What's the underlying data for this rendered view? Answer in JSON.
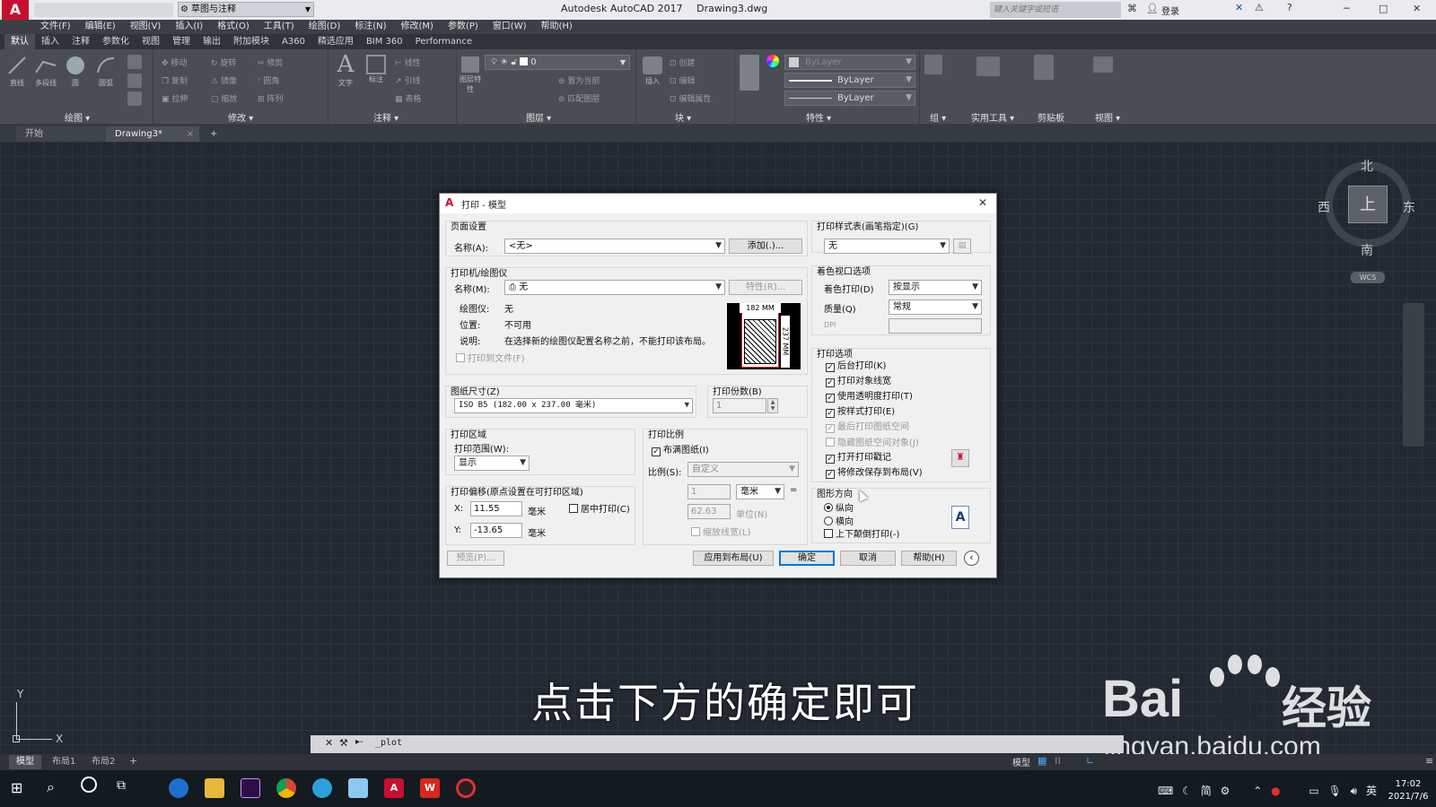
{
  "colors": {
    "canvas": "#222932",
    "dialog": "#f0f0f0",
    "accent": "#0078d7",
    "autocad_red": "#c8102e",
    "preview_red": "#e02020"
  },
  "titlebar": {
    "workspace": "草图与注释",
    "app_title": "Autodesk AutoCAD 2017",
    "file": "Drawing3.dwg",
    "search_placeholder": "键入关键字或短语",
    "login": "登录",
    "min": "─",
    "max": "□",
    "close": "✕"
  },
  "menubar": {
    "items": [
      "文件(F)",
      "编辑(E)",
      "视图(V)",
      "插入(I)",
      "格式(O)",
      "工具(T)",
      "绘图(D)",
      "标注(N)",
      "修改(M)",
      "参数(P)",
      "窗口(W)",
      "帮助(H)"
    ]
  },
  "ribbon": {
    "tabs": [
      "默认",
      "插入",
      "注释",
      "参数化",
      "视图",
      "管理",
      "输出",
      "附加模块",
      "A360",
      "精选应用",
      "BIM 360",
      "Performance"
    ],
    "draw_tools": [
      "直线",
      "多段线",
      "圆",
      "圆弧"
    ],
    "modify_tools": [
      "移动",
      "旋转",
      "修剪",
      "复制",
      "镜像",
      "圆角",
      "拉伸",
      "缩放",
      "阵列"
    ],
    "annotation_tools": [
      "文字",
      "标注",
      "线性",
      "引线",
      "表格"
    ],
    "layer_tools": [
      "图层特性",
      "置为当前",
      "匹配图层"
    ],
    "block_tools": [
      "插入",
      "创建",
      "编辑",
      "编辑属性"
    ],
    "layer_value": "0",
    "bylayer": [
      "ByLayer",
      "ByLayer",
      "ByLayer"
    ],
    "panel_labels": [
      "绘图",
      "修改",
      "注释",
      "图层",
      "块",
      "特性",
      "组",
      "实用工具",
      "剪贴板",
      "视图"
    ]
  },
  "filetabs": {
    "start": "开始",
    "current": "Drawing3*",
    "add": "+"
  },
  "viewcube": {
    "north": "北",
    "south": "南",
    "west": "西",
    "east": "东",
    "face": "上",
    "wcs": "WCS"
  },
  "ucs": {
    "y": "Y",
    "x": "X"
  },
  "dialog": {
    "title": "打印 - 模型",
    "close": "✕",
    "page_setup": {
      "title": "页面设置",
      "name_label": "名称(A):",
      "name_value": "<无>",
      "add_button": "添加(.)..."
    },
    "printer": {
      "title": "打印机/绘图仪",
      "name_label": "名称(M):",
      "name_value": "无",
      "properties_button": "特性(R)...",
      "plotter_label": "绘图仪:",
      "plotter_value": "无",
      "where_label": "位置:",
      "where_value": "不可用",
      "desc_label": "说明:",
      "desc_value": "在选择新的绘图仪配置名称之前，不能打印该布局。",
      "print_to_file": "打印到文件(F)",
      "preview_width": "182 MM",
      "preview_height": "237 MM"
    },
    "paper_size": {
      "title": "图纸尺寸(Z)",
      "value": "ISO B5 (182.00 x 237.00 毫米)"
    },
    "copies": {
      "title": "打印份数(B)",
      "value": "1"
    },
    "plot_area": {
      "title": "打印区域",
      "range_label": "打印范围(W):",
      "range_value": "显示"
    },
    "plot_offset": {
      "title": "打印偏移(原点设置在可打印区域)",
      "x_label": "X:",
      "x_value": "11.55",
      "x_unit": "毫米",
      "center_label": "居中打印(C)",
      "y_label": "Y:",
      "y_value": "-13.65",
      "y_unit": "毫米"
    },
    "plot_scale": {
      "title": "打印比例",
      "fit_paper": "布满图纸(I)",
      "fit_checked": true,
      "scale_label": "比例(S):",
      "scale_value": "自定义",
      "value1": "1",
      "unit_value": "毫米",
      "equals": "=",
      "value2": "62.63",
      "unit2": "单位(N)",
      "scale_lineweights": "缩放线宽(L)"
    },
    "style_table": {
      "title": "打印样式表(画笔指定)(G)",
      "value": "无"
    },
    "shaded": {
      "title": "着色视口选项",
      "shade_label": "着色打印(D)",
      "shade_value": "按显示",
      "quality_label": "质量(Q)",
      "quality_value": "常规",
      "dpi_label": "DPI",
      "dpi_value": ""
    },
    "plot_options": {
      "title": "打印选项",
      "items": [
        {
          "label": "后台打印(K)",
          "checked": "✓"
        },
        {
          "label": "打印对象线宽",
          "checked": "✓"
        },
        {
          "label": "使用透明度打印(T)",
          "checked": "✓"
        },
        {
          "label": "按样式打印(E)",
          "checked": "✓"
        },
        {
          "label": "最后打印图纸空间",
          "checked": "✓"
        },
        {
          "label": "隐藏图纸空间对象(J)",
          "checked": ""
        },
        {
          "label": "打开打印戳记",
          "checked": "✓"
        },
        {
          "label": "将修改保存到布局(V)",
          "checked": "✓"
        }
      ]
    },
    "orientation": {
      "title": "图形方向",
      "portrait": "纵向",
      "landscape": "横向",
      "upside_down": "上下颠倒打印(-)",
      "orientation_icon_letter": "A"
    },
    "buttons": {
      "preview": "预览(P)...",
      "apply_layout": "应用到布局(U)",
      "ok": "确定",
      "cancel": "取消",
      "help": "帮助(H)",
      "more": "‹"
    }
  },
  "subtitle": "点击下方的确定即可",
  "watermark": {
    "brand": "Bai",
    "du": "du",
    "jingyan": "经验",
    "url": "jingyan.baidu.com"
  },
  "command": {
    "text": "_plot",
    "prompt": "▸-"
  },
  "statusbar": {
    "tabs": [
      "模型",
      "布局1",
      "布局2"
    ],
    "add": "+",
    "model_button": "模型"
  },
  "taskbar": {
    "time": "17:02",
    "date": "2021/7/6",
    "lang": "英",
    "ime": "简"
  }
}
